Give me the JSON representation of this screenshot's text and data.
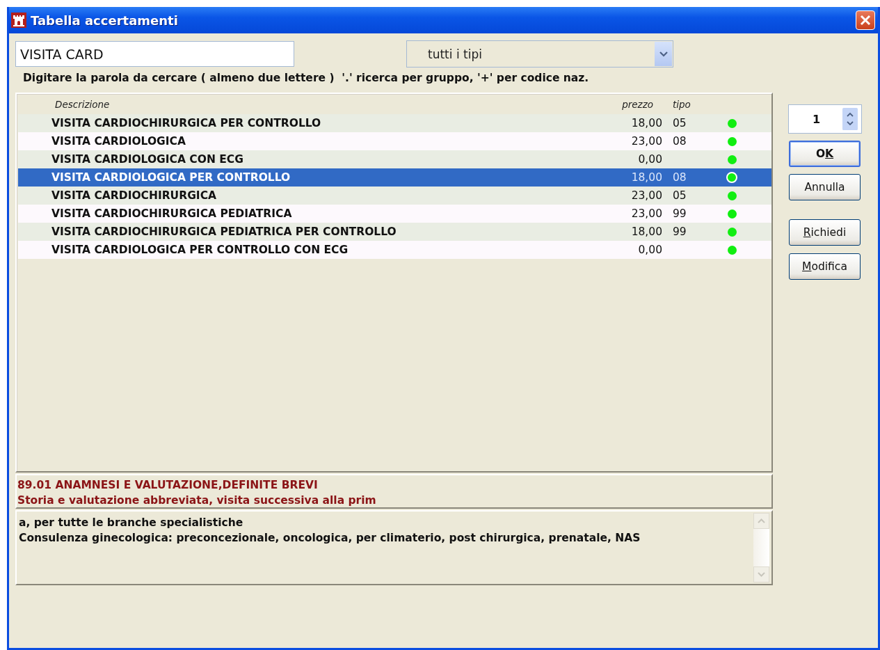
{
  "window": {
    "title": "Tabella accertamenti"
  },
  "search": {
    "value": "VISITA CARD"
  },
  "type_filter": {
    "value": "tutti i tipi"
  },
  "hint": "Digitare la parola da cercare ( almeno due lettere )  '.' ricerca per gruppo, '+' per codice naz.",
  "table": {
    "columns": [
      "Descrizione",
      "prezzo",
      "tipo"
    ],
    "rows": [
      {
        "descrizione": "VISITA CARDIOCHIRURGICA PER CONTROLLO",
        "prezzo": "18,00",
        "tipo": "05",
        "selected": false
      },
      {
        "descrizione": "VISITA CARDIOLOGICA",
        "prezzo": "23,00",
        "tipo": "08",
        "selected": false
      },
      {
        "descrizione": "VISITA CARDIOLOGICA CON ECG",
        "prezzo": "0,00",
        "selected": false
      },
      {
        "descrizione": "VISITA CARDIOLOGICA PER CONTROLLO",
        "prezzo": "18,00",
        "tipo": "08",
        "selected": true
      },
      {
        "descrizione": "VISITA CARDIOCHIRURGICA",
        "prezzo": "23,00",
        "tipo": "05",
        "selected": false
      },
      {
        "descrizione": "VISITA CARDIOCHIRURGICA PEDIATRICA",
        "prezzo": "23,00",
        "tipo": "99",
        "selected": false
      },
      {
        "descrizione": "VISITA CARDIOCHIRURGICA PEDIATRICA PER CONTROLLO",
        "prezzo": "18,00",
        "tipo": "99",
        "selected": false
      },
      {
        "descrizione": "VISITA CARDIOLOGICA PER CONTROLLO CON ECG",
        "prezzo": "0,00",
        "selected": false
      }
    ]
  },
  "details": {
    "heading": "89.01 ANAMNESI E VALUTAZIONE,DEFINITE BREVI",
    "subheading": "Storia e valutazione abbreviata, visita successiva alla prim",
    "text_lines": [
      "a, per tutte le branche specialistiche",
      "Consulenza ginecologica: preconcezionale, oncologica, per climaterio, post chirurgica, prenatale, NAS"
    ]
  },
  "quantity": {
    "value": "1"
  },
  "buttons": [
    {
      "before": "O",
      "key": "K",
      "default": true
    },
    {
      "before": "Annulla",
      "default": false
    },
    {
      "key": "R",
      "after": "ichiedi",
      "default": false
    },
    {
      "key": "M",
      "after": "odifica",
      "default": false
    }
  ]
}
